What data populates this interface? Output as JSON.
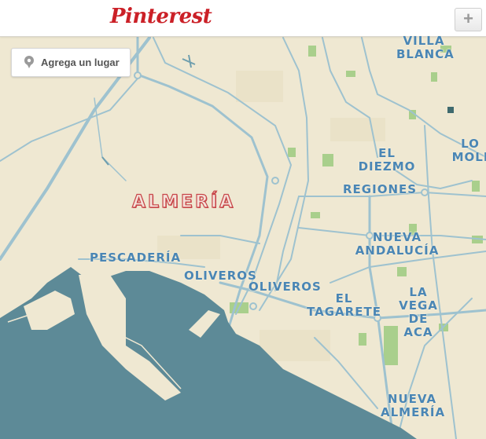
{
  "header": {
    "logo": "Pinterest",
    "add_button": "+"
  },
  "map_controls": {
    "add_place_label": "Agrega un lugar",
    "pin_icon": "map-pin-icon"
  },
  "colors": {
    "land": "#efe8d2",
    "sea": "#5d8a97",
    "road": "#9ec2cf",
    "park": "#a9cf8c",
    "label": "#4a86b5",
    "city_label": "#c8474a",
    "brand": "#cb2027"
  },
  "labels": {
    "city": "ALMERÍA",
    "villa_blanca": "VILLA BLANCA",
    "lo_moli": "LO MOLI",
    "el_diezmo": "EL DIEZMO",
    "regiones": "REGIONES",
    "nueva_andalucia": "NUEVA ANDALUCÍA",
    "pescaderia": "PESCADERÍA",
    "oliveros_1": "OLIVEROS",
    "oliveros_2": "OLIVEROS",
    "el_tagarete": "EL TAGARETE",
    "la_vega_de_aca": "LA VEGA DE ACA",
    "nueva_almeria": "NUEVA ALMERÍA"
  }
}
